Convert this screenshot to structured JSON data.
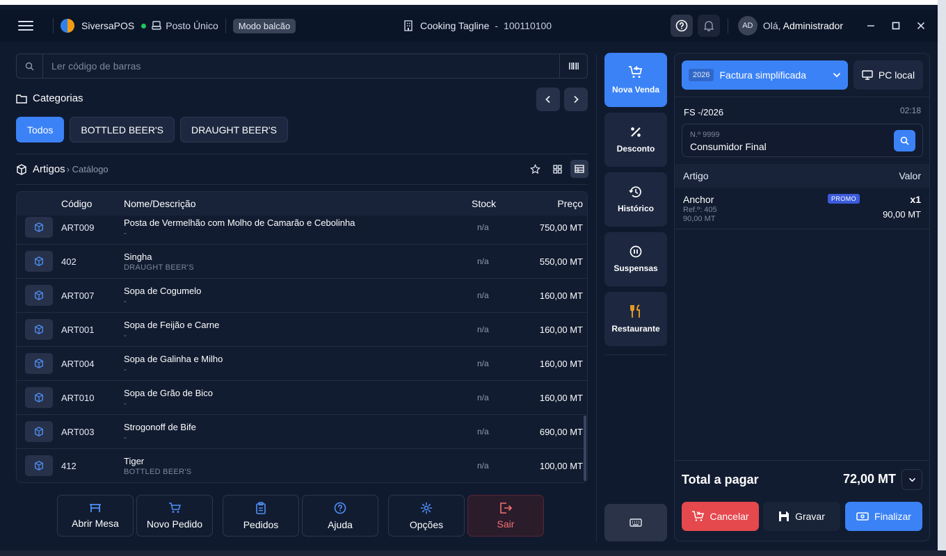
{
  "header": {
    "brand": "SiversaPOS",
    "posto": "Posto Único",
    "mode": "Modo balcão",
    "company": "Cooking Tagline",
    "separator": "-",
    "company_code": "100110100",
    "avatar_initials": "AD",
    "greeting": "Olá, ",
    "user": "Administrador",
    "icons": [
      "menu-icon",
      "help-icon",
      "bell-icon",
      "minimize-icon",
      "maximize-icon",
      "close-icon"
    ]
  },
  "search": {
    "placeholder": "Ler código de barras"
  },
  "categories": {
    "title": "Categorias",
    "items": [
      {
        "label": "Todos",
        "active": true
      },
      {
        "label": "BOTTLED BEER'S",
        "active": false
      },
      {
        "label": "DRAUGHT BEER'S",
        "active": false
      }
    ]
  },
  "articles": {
    "title": "Artigos",
    "breadcrumb": "› Catálogo",
    "columns": {
      "code": "Código",
      "name": "Nome/Descrição",
      "stock": "Stock",
      "price": "Preço"
    },
    "rows": [
      {
        "code": "ART009",
        "name": "Posta de Vermelhão com Molho de Camarão e Cebolinha",
        "sub": "-",
        "stock": "n/a",
        "price": "750,00 MT"
      },
      {
        "code": "402",
        "name": "Singha",
        "sub": "DRAUGHT BEER'S",
        "stock": "n/a",
        "price": "550,00 MT"
      },
      {
        "code": "ART007",
        "name": "Sopa de Cogumelo",
        "sub": "-",
        "stock": "n/a",
        "price": "160,00 MT"
      },
      {
        "code": "ART001",
        "name": "Sopa de Feijão e Carne",
        "sub": "-",
        "stock": "n/a",
        "price": "160,00 MT"
      },
      {
        "code": "ART004",
        "name": "Sopa de Galinha e Milho",
        "sub": "-",
        "stock": "n/a",
        "price": "160,00 MT"
      },
      {
        "code": "ART010",
        "name": "Sopa de Grão de Bico",
        "sub": "-",
        "stock": "n/a",
        "price": "160,00 MT"
      },
      {
        "code": "ART003",
        "name": "Strogonoff de Bife",
        "sub": "-",
        "stock": "n/a",
        "price": "690,00 MT"
      },
      {
        "code": "412",
        "name": "Tiger",
        "sub": "BOTTLED BEER'S",
        "stock": "n/a",
        "price": "100,00 MT"
      }
    ]
  },
  "bottom_actions": {
    "open_table": "Abrir Mesa",
    "new_order": "Novo Pedido",
    "orders": "Pedidos",
    "help": "Ajuda",
    "options": "Opções",
    "exit": "Sair"
  },
  "side_actions": {
    "new_sale": "Nova Venda",
    "discount": "Desconto",
    "history": "Histórico",
    "suspended": "Suspensas",
    "restaurant": "Restaurante"
  },
  "document": {
    "year": "2026",
    "type": "Factura simplificada",
    "terminal": "PC local",
    "number": "FS -/2026",
    "time": "02:18",
    "client_nif": "N.º 9999",
    "client_name": "Consumidor Final"
  },
  "cart": {
    "col_item": "Artigo",
    "col_value": "Valor",
    "items": [
      {
        "name": "Anchor",
        "badge": "PROMO",
        "ref": "Ref.º: 405",
        "unit_price": "90,00 MT",
        "qty": "x1",
        "total": "90,00 MT"
      }
    ]
  },
  "totals": {
    "label": "Total a pagar",
    "value": "72,00 MT"
  },
  "cart_actions": {
    "cancel": "Cancelar",
    "save": "Gravar",
    "finish": "Finalizar"
  },
  "colors": {
    "accent": "#3b82f6",
    "danger": "#e5484d",
    "background": "#101a2f",
    "panel": "#121c31"
  }
}
